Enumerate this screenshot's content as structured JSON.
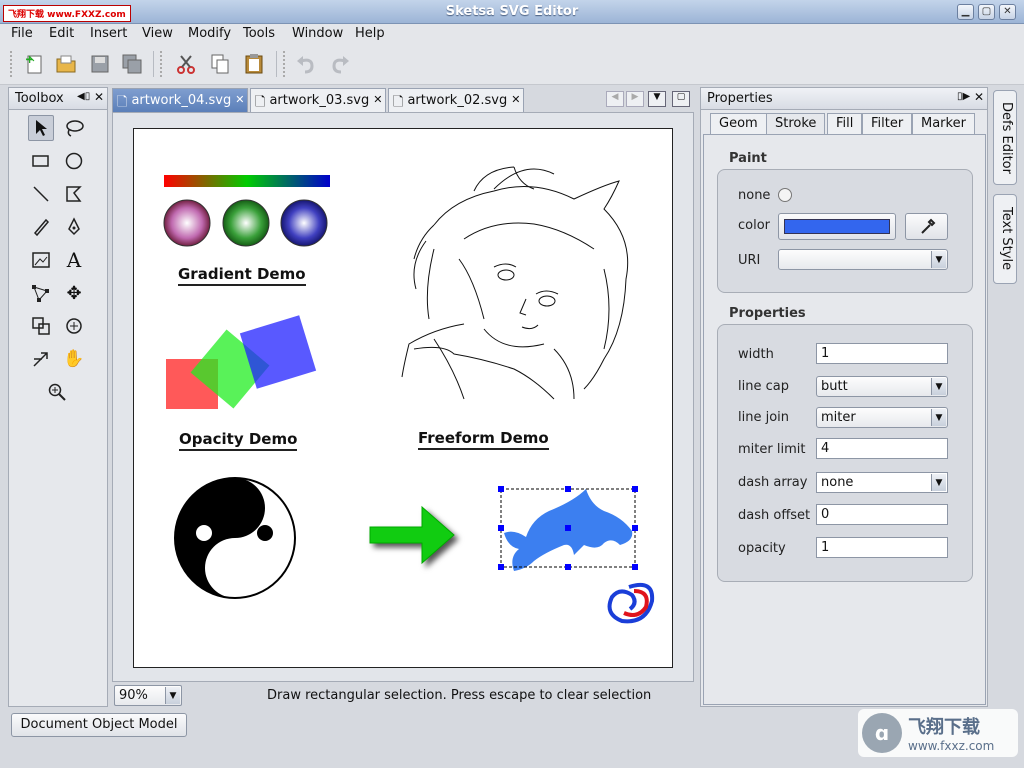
{
  "window": {
    "title": "Sketsa SVG Editor",
    "watermark_top": "飞翔下载 www.FXXZ.com"
  },
  "menus": [
    "File",
    "Edit",
    "Insert",
    "View",
    "Modify",
    "Tools",
    "Window",
    "Help"
  ],
  "toolbox": {
    "title": "Toolbox"
  },
  "tabs": [
    "artwork_04.svg",
    "artwork_03.svg",
    "artwork_02.svg"
  ],
  "canvas": {
    "gradient_title": "Gradient Demo",
    "opacity_title": "Opacity Demo",
    "freeform_title": "Freeform Demo"
  },
  "statusbar": {
    "zoom": "90%",
    "message": "Draw rectangular selection. Press escape to clear selection"
  },
  "dom_button": "Document Object Model",
  "properties": {
    "title": "Properties",
    "tabs": [
      "Geom",
      "Stroke",
      "Fill",
      "Filter",
      "Marker"
    ],
    "paint": {
      "heading": "Paint",
      "none_label": "none",
      "color_label": "color",
      "color_value": "#3366ee",
      "uri_label": "URI",
      "uri_value": ""
    },
    "props": {
      "heading": "Properties",
      "width_label": "width",
      "width_value": "1",
      "linecap_label": "line cap",
      "linecap_value": "butt",
      "linejoin_label": "line join",
      "linejoin_value": "miter",
      "miterlimit_label": "miter limit",
      "miterlimit_value": "4",
      "dasharray_label": "dash array",
      "dasharray_value": "none",
      "dashoffset_label": "dash offset",
      "dashoffset_value": "0",
      "opacity_label": "opacity",
      "opacity_value": "1"
    }
  },
  "side_tabs": [
    "Defs Editor",
    "Text Style"
  ],
  "watermark_bottom": {
    "brand": "飞翔下载",
    "url": "www.fxxz.com"
  }
}
